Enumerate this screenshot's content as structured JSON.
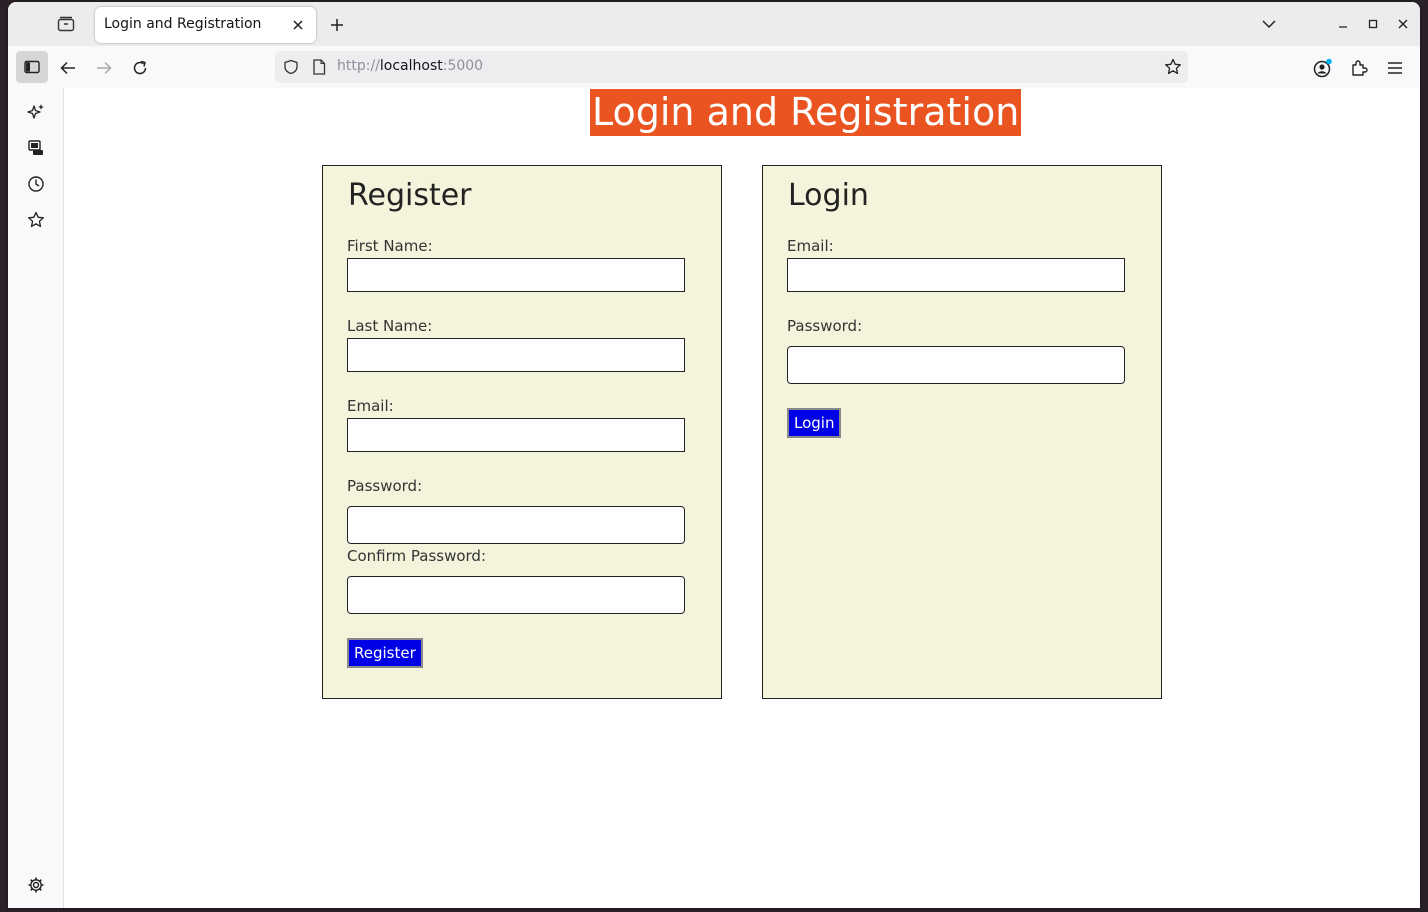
{
  "browser": {
    "tab_title": "Login and Registration",
    "url_scheme": "http://",
    "url_host": "localhost",
    "url_port": ":5000"
  },
  "page": {
    "title": "Login and Registration",
    "title_bg": "#e95420",
    "panel_bg": "#f3f4db",
    "button_color": "#0000e6"
  },
  "register": {
    "heading": "Register",
    "first_name_label": "First Name:",
    "last_name_label": "Last Name:",
    "email_label": "Email:",
    "password_label": "Password:",
    "confirm_password_label": "Confirm Password:",
    "submit_label": "Register"
  },
  "login": {
    "heading": "Login",
    "email_label": "Email:",
    "password_label": "Password:",
    "submit_label": "Login"
  }
}
